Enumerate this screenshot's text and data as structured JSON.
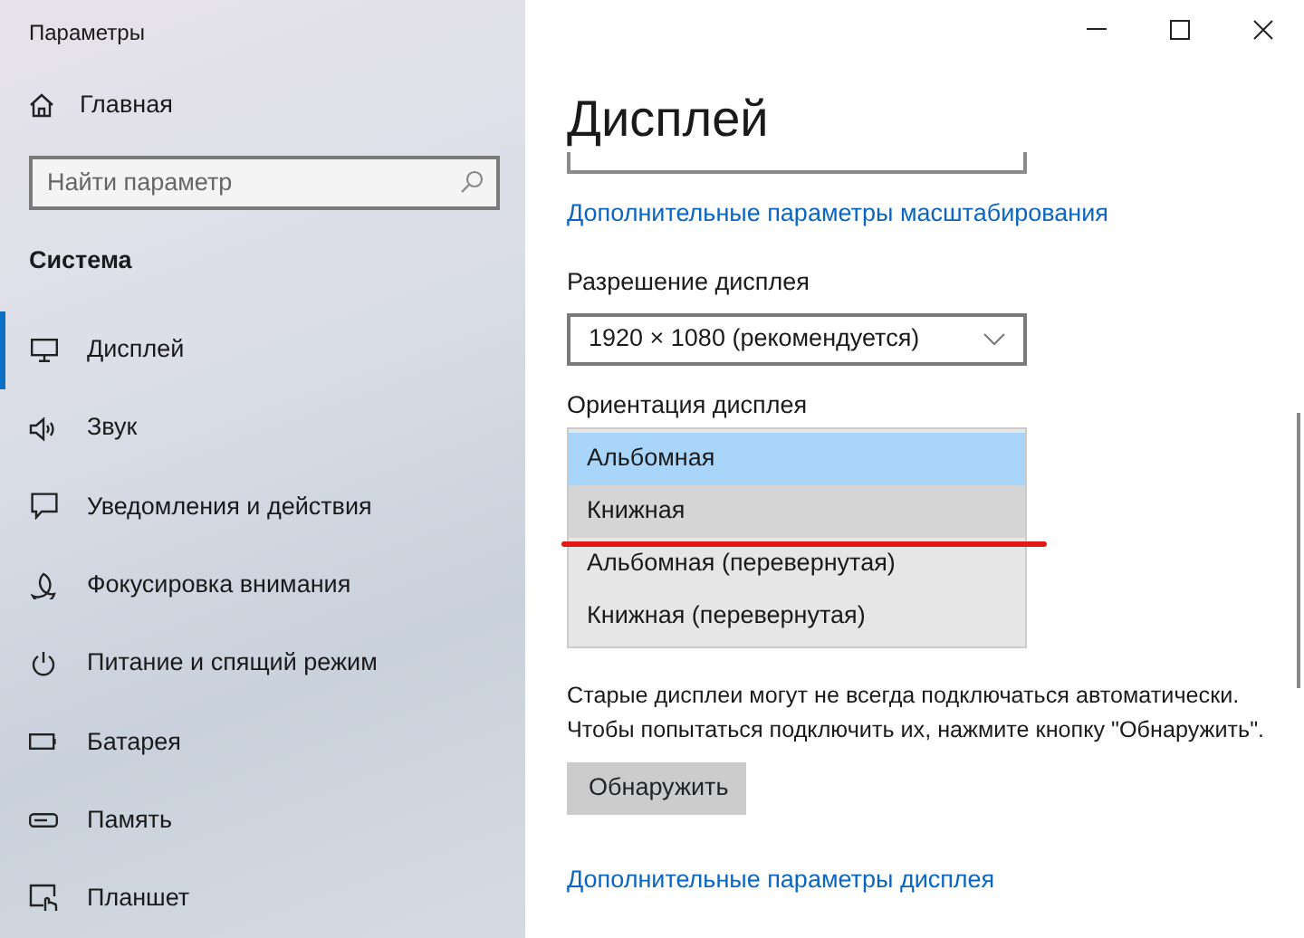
{
  "window": {
    "title": "Параметры"
  },
  "sidebar": {
    "home": "Главная",
    "search": {
      "placeholder": "Найти параметр"
    },
    "section": "Система",
    "items": [
      {
        "label": "Дисплей",
        "selected": true
      },
      {
        "label": "Звук",
        "selected": false
      },
      {
        "label": "Уведомления и действия",
        "selected": false
      },
      {
        "label": "Фокусировка внимания",
        "selected": false
      },
      {
        "label": "Питание и спящий режим",
        "selected": false
      },
      {
        "label": "Батарея",
        "selected": false
      },
      {
        "label": "Память",
        "selected": false
      },
      {
        "label": "Планшет",
        "selected": false
      }
    ]
  },
  "content": {
    "title": "Дисплей",
    "scale_link": "Дополнительные параметры масштабирования",
    "resolution": {
      "label": "Разрешение дисплея",
      "value": "1920 × 1080 (рекомендуется)"
    },
    "orientation": {
      "label": "Ориентация дисплея",
      "options": [
        {
          "label": "Альбомная",
          "selected": true,
          "hovered": false,
          "underlined": false
        },
        {
          "label": "Книжная",
          "selected": false,
          "hovered": true,
          "underlined": true
        },
        {
          "label": "Альбомная (перевернутая)",
          "selected": false,
          "hovered": false,
          "underlined": false
        },
        {
          "label": "Книжная (перевернутая)",
          "selected": false,
          "hovered": false,
          "underlined": false
        }
      ]
    },
    "detect_text": "Старые дисплеи могут не всегда подключаться автоматически. Чтобы попытаться подключить их, нажмите кнопку \"Обнаружить\".",
    "detect_button": "Обнаружить",
    "advanced_link": "Дополнительные параметры дисплея"
  }
}
